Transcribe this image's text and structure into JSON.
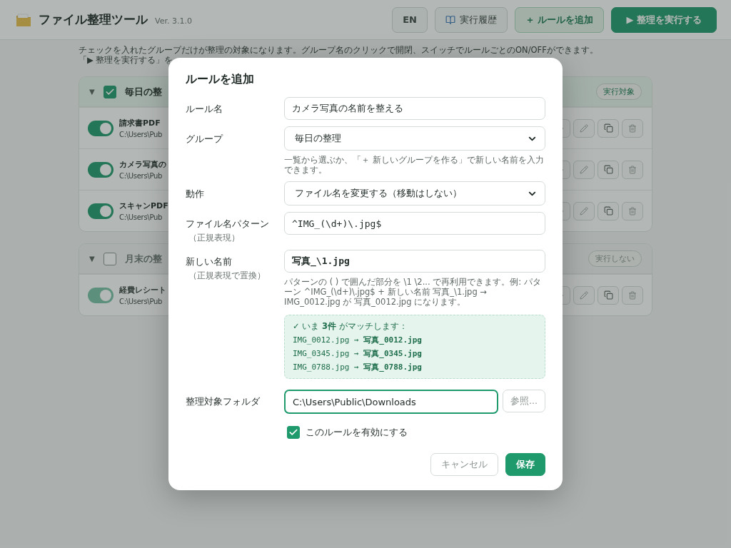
{
  "header": {
    "app_name": "ファイル整理ツール",
    "version": "Ver. 3.1.0",
    "buttons": [
      {
        "kind": "plain",
        "label": "EN"
      },
      {
        "kind": "history",
        "label": "実行履歴"
      },
      {
        "kind": "soft",
        "label": "＋ ルールを追加"
      },
      {
        "kind": "primary",
        "label": "▶ 整理を実行する"
      }
    ]
  },
  "intro": [
    "チェックを入れたグループだけが整理の対象になります。グループ名のクリックで開閉、スイッチでルールごとのON/OFFができます。",
    "「▶ 整理を実行する」を"
  ],
  "groups": [
    {
      "caret": "▼",
      "name": "毎日の整",
      "checked": true,
      "badge": "実行対象",
      "rules": [
        {
          "name": "請求書PDF",
          "path": "C:\\Users\\Pub",
          "on": true
        },
        {
          "name": "カメラ写真の",
          "path": "C:\\Users\\Pub",
          "on": true
        },
        {
          "name": "スキャンPDF",
          "path": "C:\\Users\\Pub",
          "on": true
        }
      ]
    },
    {
      "caret": "▼",
      "name": "月末の整",
      "checked": false,
      "badge": "実行しない",
      "rules": [
        {
          "name": "経費レシート",
          "path": "C:\\Users\\Pub",
          "on": true
        }
      ]
    }
  ],
  "dialog": {
    "title": "ルールを追加",
    "fields": [
      {
        "kind": "text",
        "label": "ルール名",
        "value": "カメラ写真の名前を整える"
      },
      {
        "kind": "select",
        "label": "グループ",
        "value": "毎日の整理",
        "hint": "一覧から選ぶか、「＋ 新しいグループを作る」で新しい名前を入力できます。"
      },
      {
        "kind": "select",
        "label": "動作",
        "value": "ファイル名を変更する（移動はしない）"
      },
      {
        "kind": "code",
        "label": "ファイル名パターン",
        "sublabel": "（正規表現）",
        "value": "^IMG_(\\d+)\\.jpg$"
      },
      {
        "kind": "code",
        "label": "新しい名前",
        "sublabel": "（正規表現で置換）",
        "value": "写真_\\1.jpg",
        "hint": "パターンの ( ) で囲んだ部分を \\1 \\2... で再利用できます。例: パターン ^IMG_(\\d+)\\.jpg$ + 新しい名前 写真_\\1.jpg → IMG_0012.jpg が 写真_0012.jpg になります。"
      }
    ],
    "preview": {
      "summary": "✓ いま **3件** がマッチします：",
      "lines": [
        "IMG_0012.jpg → **写真_0012.jpg**",
        "IMG_0345.jpg → **写真_0345.jpg**",
        "IMG_0788.jpg → **写真_0788.jpg**"
      ]
    },
    "folder": {
      "label": "整理対象フォルダ",
      "value": "C:\\Users\\Public\\Downloads",
      "focused": true,
      "browse": "参照..."
    },
    "enabled": {
      "label": "このルールを有効にする",
      "checked": true
    },
    "buttons": [
      {
        "kind": "secondary",
        "label": "キャンセル"
      },
      {
        "kind": "primary",
        "label": "保存"
      }
    ]
  }
}
